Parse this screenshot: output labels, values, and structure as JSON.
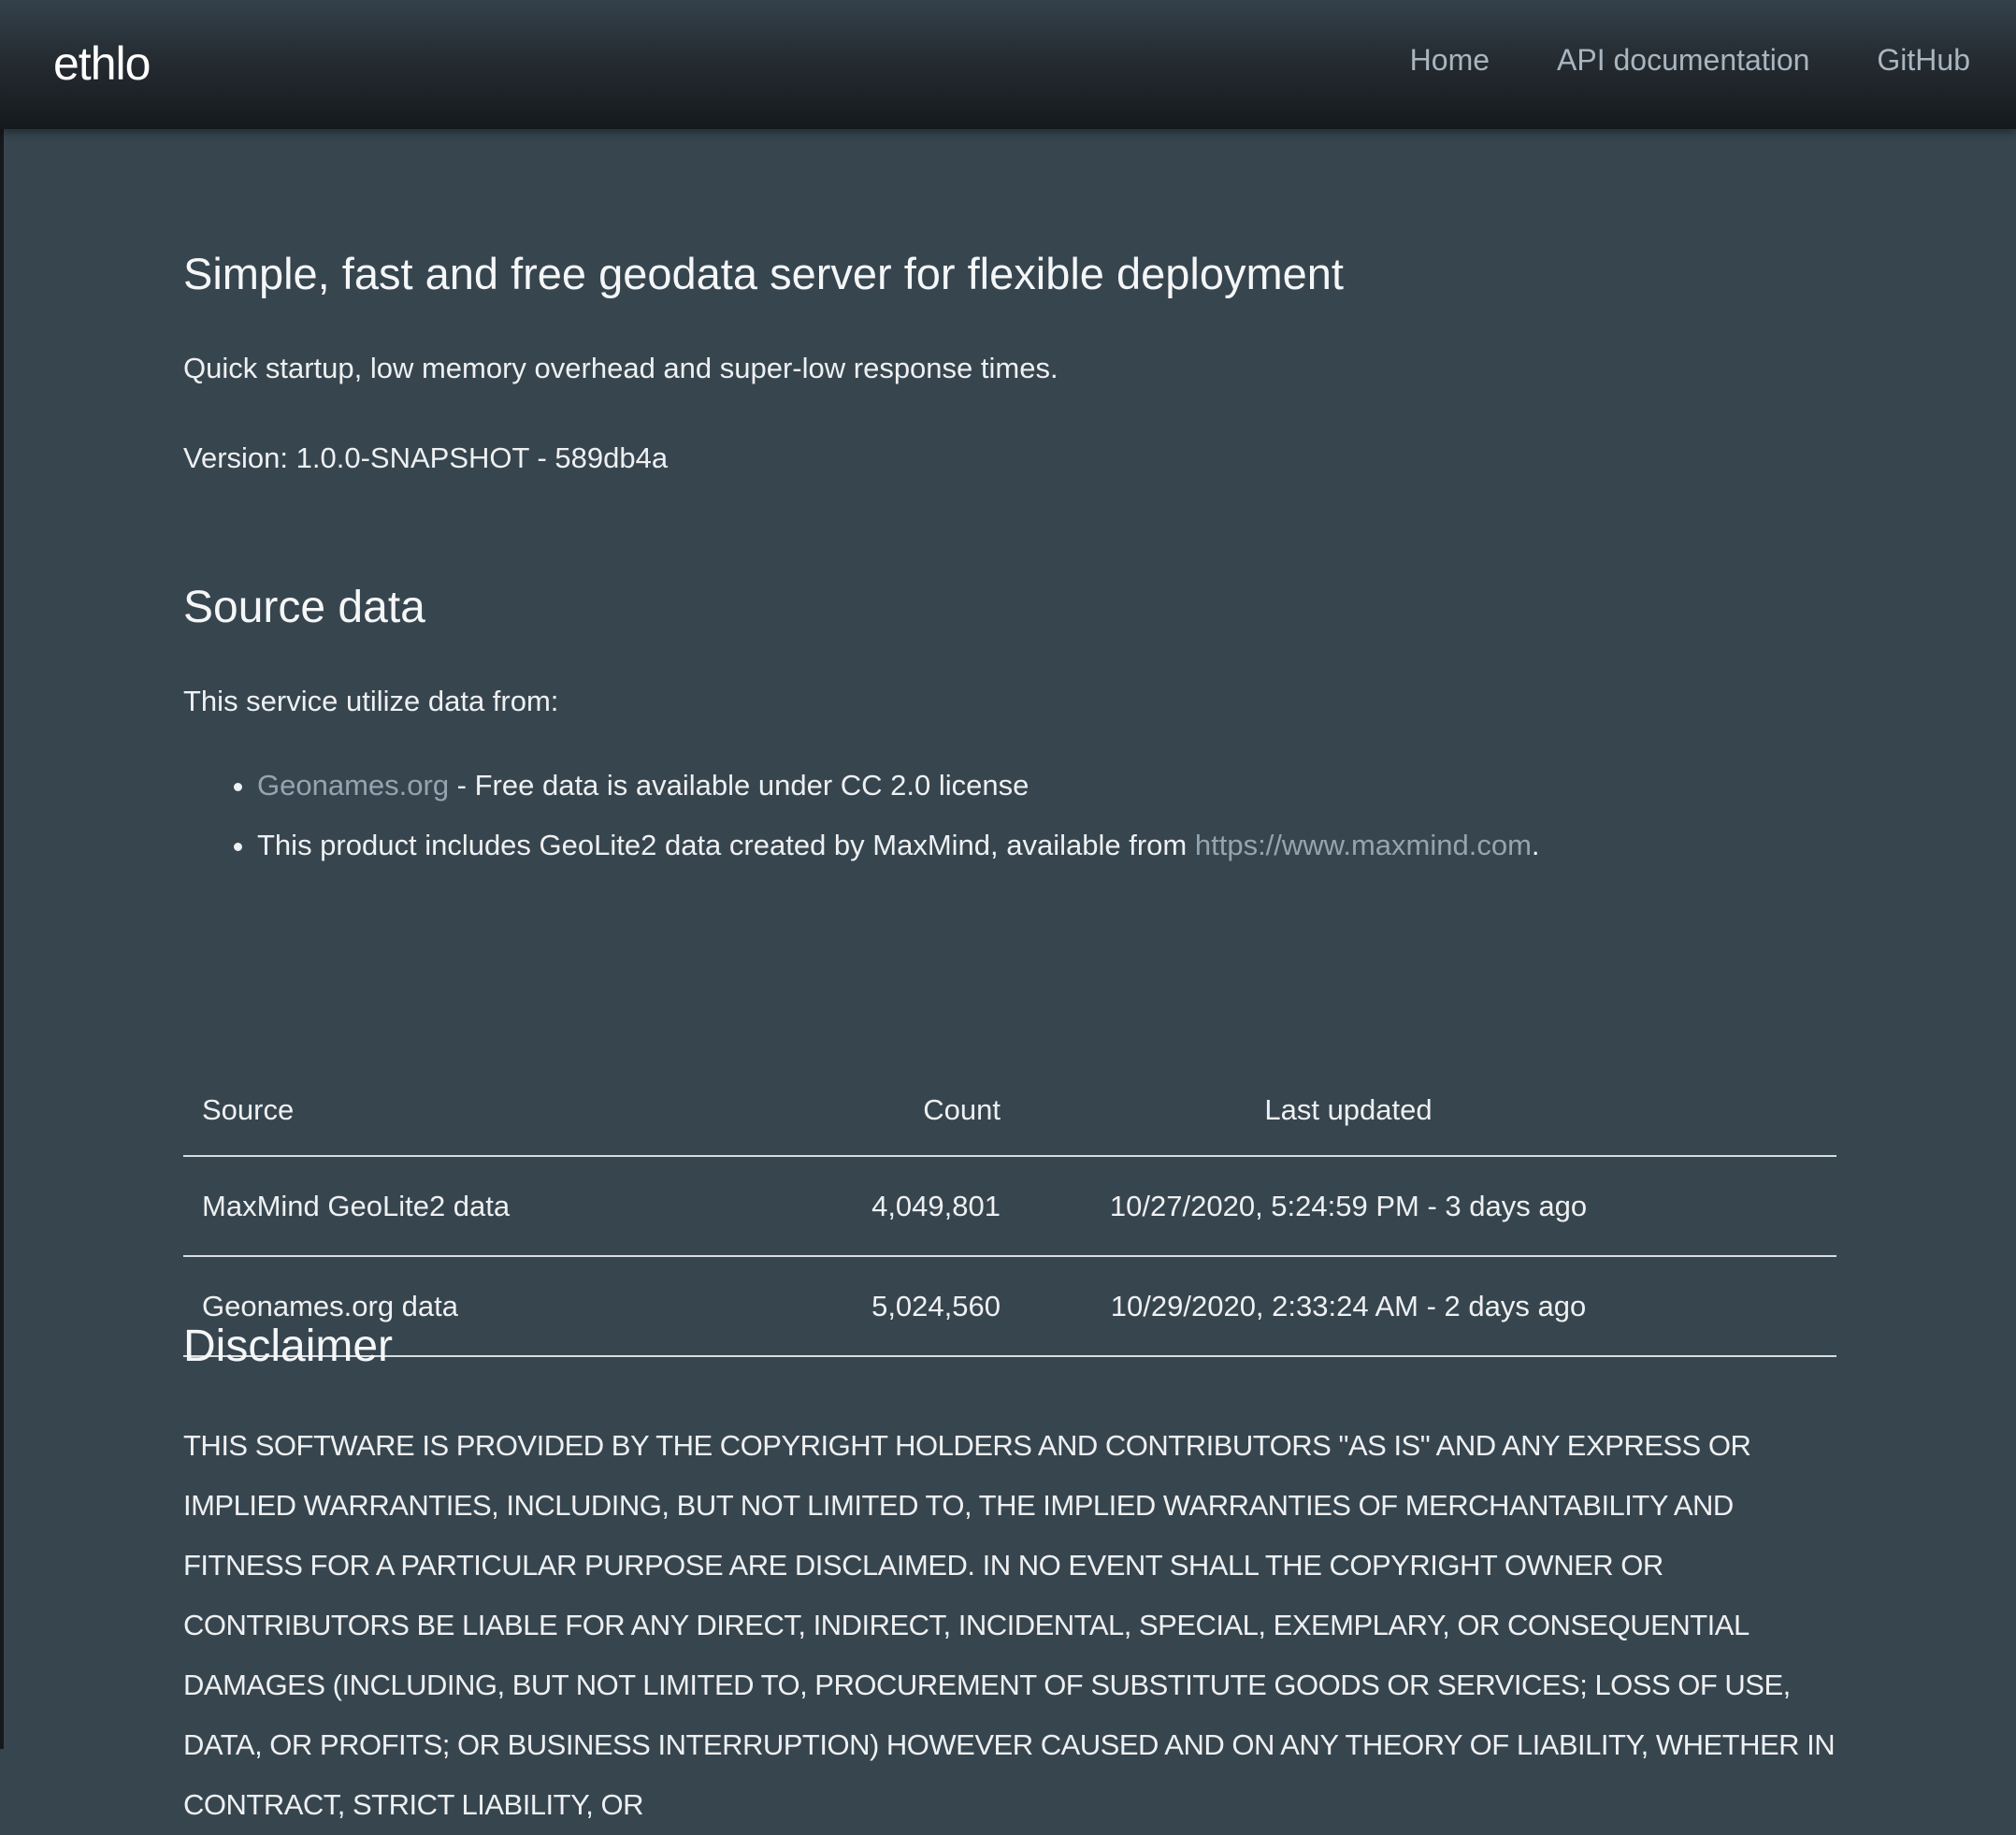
{
  "header": {
    "brand": "ethlo",
    "nav": [
      {
        "label": "Home"
      },
      {
        "label": "API documentation"
      },
      {
        "label": "GitHub"
      }
    ]
  },
  "intro": {
    "headline": "Simple, fast and free geodata server for flexible deployment",
    "subtitle": "Quick startup, low memory overhead and super-low response times.",
    "version": "Version: 1.0.0-SNAPSHOT - 589db4a"
  },
  "source_data": {
    "title": "Source data",
    "intro": "This service utilize data from:",
    "items": [
      {
        "link_text": "Geonames.org",
        "text": " - Free data is available under CC 2.0 license"
      },
      {
        "text": "This product includes GeoLite2 data created by MaxMind, available from ",
        "link_text": "https://www.maxmind.com",
        "suffix": "."
      }
    ],
    "table": {
      "headers": [
        "Source",
        "Count",
        "Last updated"
      ],
      "rows": [
        [
          "MaxMind GeoLite2 data",
          "4,049,801",
          "10/27/2020, 5:24:59 PM - 3 days ago"
        ],
        [
          "Geonames.org data",
          "5,024,560",
          "10/29/2020, 2:33:24 AM - 2 days ago"
        ]
      ]
    }
  },
  "disclaimer": {
    "title": "Disclaimer",
    "text": "THIS SOFTWARE IS PROVIDED BY THE COPYRIGHT HOLDERS AND CONTRIBUTORS \"AS IS\" AND ANY EXPRESS OR IMPLIED WARRANTIES, INCLUDING, BUT NOT LIMITED TO, THE IMPLIED WARRANTIES OF MERCHANTABILITY AND FITNESS FOR A PARTICULAR PURPOSE ARE DISCLAIMED. IN NO EVENT SHALL THE COPYRIGHT OWNER OR CONTRIBUTORS BE LIABLE FOR ANY DIRECT, INDIRECT, INCIDENTAL, SPECIAL, EXEMPLARY, OR CONSEQUENTIAL DAMAGES (INCLUDING, BUT NOT LIMITED TO, PROCUREMENT OF SUBSTITUTE GOODS OR SERVICES; LOSS OF USE, DATA, OR PROFITS; OR BUSINESS INTERRUPTION) HOWEVER CAUSED AND ON ANY THEORY OF LIABILITY, WHETHER IN CONTRACT, STRICT LIABILITY, OR"
  },
  "colors": {
    "background": "#37454f",
    "header_dark": "#15191c",
    "link": "#95a5b0",
    "nav_link": "#a9b5bf"
  }
}
